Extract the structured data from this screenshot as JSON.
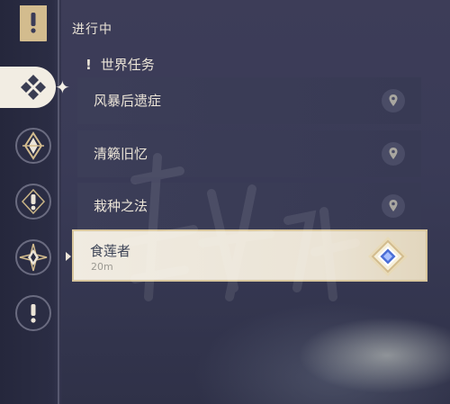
{
  "header": {
    "title": "进行中"
  },
  "category": {
    "label": "世界任务",
    "icon": "exclamation-icon"
  },
  "quests": [
    {
      "name": "风暴后遗症"
    },
    {
      "name": "清籁旧忆"
    },
    {
      "name": "栽种之法"
    }
  ],
  "active_quest": {
    "name": "食莲者",
    "distance": "20m"
  },
  "rail": {
    "tabs": [
      "bookmark-exclamation-icon",
      "diamonds-icon",
      "inazuma-emblem-icon",
      "exclamation-icon",
      "star-compass-icon",
      "exclamation-icon"
    ]
  },
  "colors": {
    "gold": "#d3bc8e",
    "text": "#ece5d8",
    "active_bg": "#f0ebe1",
    "marker_blue": "#4b6fd6"
  }
}
